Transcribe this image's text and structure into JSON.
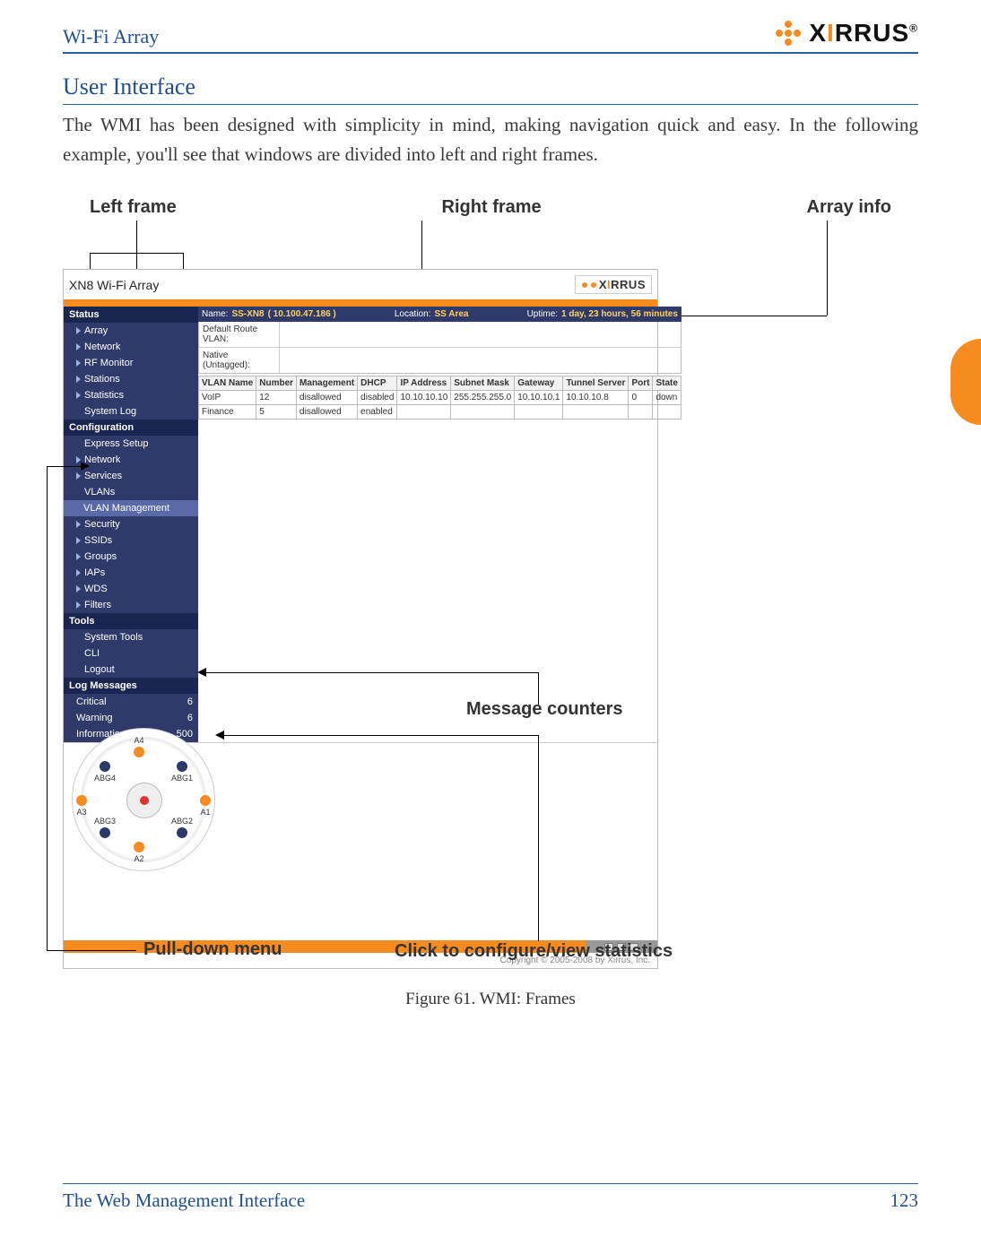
{
  "header": {
    "running_head": "Wi-Fi Array",
    "brand": "XIRRUS"
  },
  "section_title": "User Interface",
  "body_paragraph": "The WMI has been designed with simplicity in mind, making navigation quick and easy. In the following example, you'll see that windows are divided into left and right frames.",
  "annotations": {
    "left_frame": "Left frame",
    "right_frame": "Right frame",
    "array_info": "Array info",
    "message_counters": "Message counters",
    "pulldown": "Pull-down menu",
    "click_configure": "Click to configure/view statistics"
  },
  "screenshot": {
    "model": "XN8 Wi-Fi Array",
    "brand": "XIRRUS",
    "infobar": {
      "name_label": "Name:",
      "name_value": "SS-XN8",
      "ip": "( 10.100.47.186 )",
      "location_label": "Location:",
      "location_value": "SS Area",
      "uptime_label": "Uptime:",
      "uptime_value": "1 day, 23 hours, 56 minutes"
    },
    "meta": {
      "default_route_label": "Default Route VLAN:",
      "default_route_value": "",
      "native_label": "Native (Untagged):",
      "native_value": ""
    },
    "vlan_headers": [
      "VLAN Name",
      "Number",
      "Management",
      "DHCP",
      "IP Address",
      "Subnet Mask",
      "Gateway",
      "Tunnel Server",
      "Port",
      "State"
    ],
    "vlan_rows": [
      {
        "name": "VoIP",
        "number": "12",
        "mgmt": "disallowed",
        "dhcp": "disabled",
        "ip": "10.10.10.10",
        "mask": "255.255.255.0",
        "gw": "10.10.10.1",
        "tun": "10.10.10.8",
        "port": "0",
        "state": "down"
      },
      {
        "name": "Finance",
        "number": "5",
        "mgmt": "disallowed",
        "dhcp": "enabled",
        "ip": "",
        "mask": "",
        "gw": "",
        "tun": "",
        "port": "",
        "state": ""
      }
    ],
    "nav": {
      "status": "Status",
      "status_items": [
        "Array",
        "Network",
        "RF Monitor",
        "Stations",
        "Statistics",
        "System Log"
      ],
      "config": "Configuration",
      "config_items": [
        "Express Setup",
        "Network",
        "Services",
        "VLANs"
      ],
      "vlan_sub": "VLAN Management",
      "config_items2": [
        "Security",
        "SSIDs",
        "Groups",
        "IAPs",
        "WDS",
        "Filters"
      ],
      "tools": "Tools",
      "tools_items": [
        "System Tools",
        "CLI",
        "Logout"
      ],
      "log": "Log Messages",
      "log_rows": [
        {
          "label": "Critical",
          "value": "6"
        },
        {
          "label": "Warning",
          "value": "6"
        },
        {
          "label": "Information",
          "value": "500"
        }
      ]
    },
    "copyright": "Copyright © 2005-2008 by Xirrus, Inc.",
    "radial": {
      "n1": "A4",
      "n2": "ABG4",
      "n3": "ABG1",
      "n4": "A3",
      "n5": "A1",
      "n6": "ABG3",
      "n7": "ABG2",
      "n8": "A2"
    }
  },
  "figure_caption": "Figure 61. WMI: Frames",
  "footer": {
    "section": "The Web Management Interface",
    "page": "123"
  }
}
